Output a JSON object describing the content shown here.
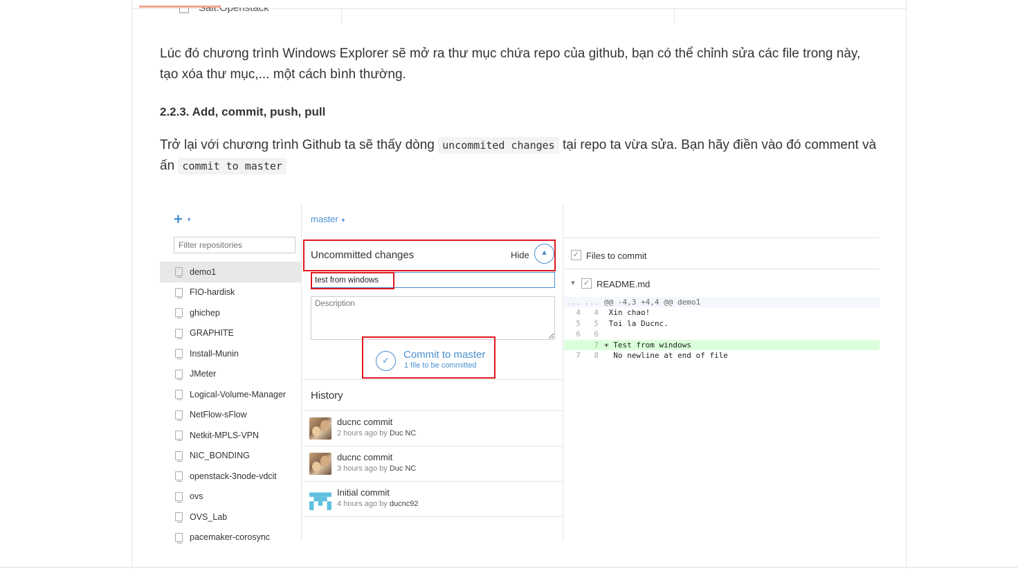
{
  "top_fragment": {
    "text": "Salt.Openstack"
  },
  "paragraph1": "Lúc đó chương trình Windows Explorer sẽ mở ra thư mục chứa repo của github, bạn có thể chỉnh sửa các file trong này, tạo xóa thư mục,... một cách bình thường.",
  "heading": "2.2.3. Add, commit, push, pull",
  "paragraph2": {
    "before": "Trở lại với chương trình Github ta sẽ thấy dòng ",
    "code1": "uncommited changes",
    "middle": " tại repo ta vừa sửa. Bạn hãy điền vào đó comment và ấn ",
    "code2": "commit to master"
  },
  "app": {
    "add_button": "+",
    "add_caret": "▾",
    "filter_placeholder": "Filter repositories",
    "repos": [
      {
        "name": "demo1",
        "selected": true
      },
      {
        "name": "FIO-hardisk"
      },
      {
        "name": "ghichep"
      },
      {
        "name": "GRAPHITE"
      },
      {
        "name": "Install-Munin"
      },
      {
        "name": "JMeter"
      },
      {
        "name": "Logical-Volume-Manager"
      },
      {
        "name": "NetFlow-sFlow"
      },
      {
        "name": "Netkit-MPLS-VPN"
      },
      {
        "name": "NIC_BONDING"
      },
      {
        "name": "openstack-3node-vdcit"
      },
      {
        "name": "ovs"
      },
      {
        "name": "OVS_Lab"
      },
      {
        "name": "pacemaker-corosync"
      }
    ],
    "branch": "master",
    "branch_caret": "▾",
    "uncommitted_title": "Uncommitted changes",
    "hide_label": "Hide",
    "summary_value": "test from windows",
    "description_placeholder": "Description",
    "commit_button": "Commit to master",
    "commit_sub": "1 file to be committed",
    "history_title": "History",
    "history": [
      {
        "title": "ducnc commit",
        "time": "2 hours ago by",
        "author": "Duc NC",
        "avatar": "photo"
      },
      {
        "title": "ducnc commit",
        "time": "3 hours ago by",
        "author": "Duc NC",
        "avatar": "photo"
      },
      {
        "title": "Initial commit",
        "time": "4 hours ago by",
        "author": "ducnc92",
        "avatar": "identicon"
      }
    ],
    "files_to_commit": "Files to commit",
    "file_name": "README.md",
    "diff": [
      {
        "n1": "...",
        "n2": "...",
        "code": "@@ -4,3 +4,4 @@ demo1",
        "kind": "hunk"
      },
      {
        "n1": "4",
        "n2": "4",
        "code": " Xin chao!",
        "kind": "context"
      },
      {
        "n1": "5",
        "n2": "5",
        "code": " Toi la Ducnc.",
        "kind": "context"
      },
      {
        "n1": "6",
        "n2": "6",
        "code": "",
        "kind": "context"
      },
      {
        "n1": "",
        "n2": "7",
        "code": "+ Test from windows",
        "kind": "added"
      },
      {
        "n1": "7",
        "n2": "8",
        "code": "  No newline at end of file",
        "kind": "context"
      }
    ]
  },
  "colors": {
    "accent": "#4a8fd2",
    "highlight": "#e0161e",
    "added_bg": "#dbffdb"
  }
}
